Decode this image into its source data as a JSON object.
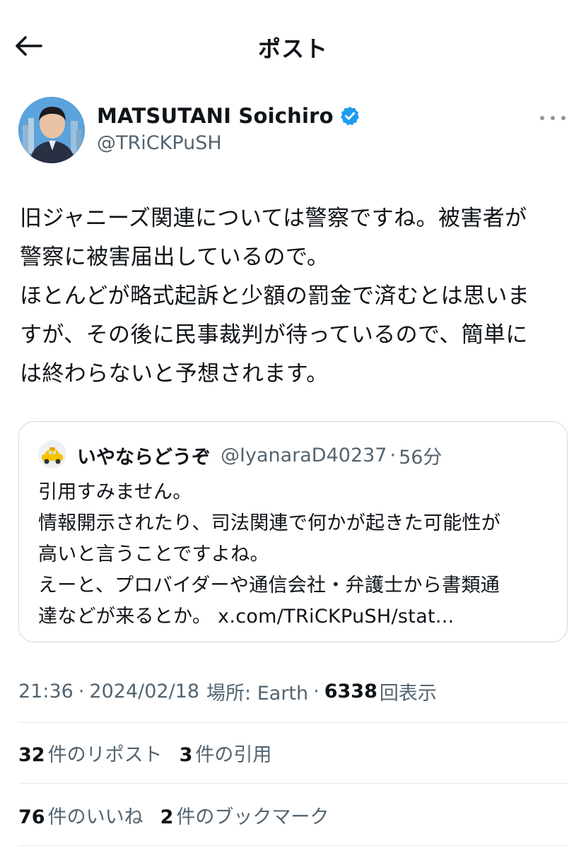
{
  "header": {
    "title": "ポスト",
    "back_icon": "arrow-left-icon"
  },
  "author": {
    "name": "MATSUTANI Soichiro",
    "handle": "@TRiCKPuSH",
    "verified": true,
    "verified_color": "#1d9bf0"
  },
  "post": {
    "lines": [
      "旧ジャニーズ関連については警察ですね。被害者が",
      "警察に被害届出しているので。",
      "ほとんどが略式起訴と少額の罰金で済むとは思いま",
      "すが、その後に民事裁判が待っているので、簡単に",
      "は終わらないと予想されます。"
    ]
  },
  "quote": {
    "name": "いやならどうぞ",
    "handle": "@IyanaraD40237",
    "separator": "·",
    "time": "56分",
    "lines": [
      "引用すみません。",
      "情報開示されたり、司法関連で何かが起きた可能性が",
      "高いと言うことですよね。",
      "えーと、プロバイダーや通信会社・弁護士から書類通",
      "達などが来るとか。 x.com/TRiCKPuSH/stat..."
    ]
  },
  "meta": {
    "time": "21:36",
    "date": "2024/02/18",
    "location": "場所: Earth",
    "separator": "·",
    "views_count": "6338",
    "views_label": "回表示"
  },
  "stats": {
    "reposts_count": "32",
    "reposts_label": "件のリポスト",
    "quotes_count": "3",
    "quotes_label": "件の引用",
    "likes_count": "76",
    "likes_label": "件のいいね",
    "bookmarks_count": "2",
    "bookmarks_label": "件のブックマーク"
  },
  "colors": {
    "text": "#0f1419",
    "secondary": "#536471",
    "border": "#cfd9de"
  }
}
